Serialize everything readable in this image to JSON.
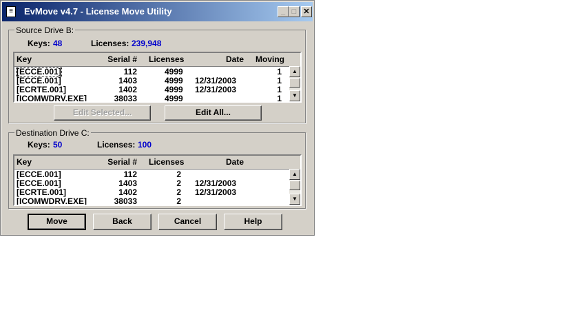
{
  "window": {
    "title": "EvMove v4.7 - License Move Utility",
    "min_glyph": "_",
    "max_glyph": "□",
    "close_glyph": "✕"
  },
  "source": {
    "label": "Source Drive B:",
    "keys_label": "Keys:",
    "keys_value": "48",
    "licenses_label": "Licenses:",
    "licenses_value": "239,948",
    "columns": {
      "key": "Key",
      "serial": "Serial #",
      "licenses": "Licenses",
      "date": "Date",
      "moving": "Moving"
    },
    "rows": [
      {
        "key": "[ECCE.001]",
        "serial": "112",
        "licenses": "4999",
        "date": "",
        "moving": "1"
      },
      {
        "key": "[ECCE.001]",
        "serial": "1403",
        "licenses": "4999",
        "date": "12/31/2003",
        "moving": "1"
      },
      {
        "key": "[ECRTE.001]",
        "serial": "1402",
        "licenses": "4999",
        "date": "12/31/2003",
        "moving": "1"
      },
      {
        "key": "[ICOMWDRV.EXE]",
        "serial": "38033",
        "licenses": "4999",
        "date": "",
        "moving": "1"
      }
    ],
    "edit_selected_label": "Edit Selected...",
    "edit_all_label": "Edit All..."
  },
  "destination": {
    "label": "Destination Drive C:",
    "keys_label": "Keys:",
    "keys_value": "50",
    "licenses_label": "Licenses:",
    "licenses_value": "100",
    "columns": {
      "key": "Key",
      "serial": "Serial #",
      "licenses": "Licenses",
      "date": "Date"
    },
    "rows": [
      {
        "key": "[ECCE.001]",
        "serial": "112",
        "licenses": "2",
        "date": ""
      },
      {
        "key": "[ECCE.001]",
        "serial": "1403",
        "licenses": "2",
        "date": "12/31/2003"
      },
      {
        "key": "[ECRTE.001]",
        "serial": "1402",
        "licenses": "2",
        "date": "12/31/2003"
      },
      {
        "key": "[ICOMWDRV.EXE]",
        "serial": "38033",
        "licenses": "2",
        "date": ""
      }
    ]
  },
  "buttons": {
    "move": "Move",
    "back": "Back",
    "cancel": "Cancel",
    "help": "Help"
  },
  "icons": {
    "app": "app-document-icon",
    "scroll_up": "▲",
    "scroll_down": "▼"
  },
  "colors": {
    "title_start": "#0a246a",
    "title_end": "#a6caf0",
    "value_blue": "#0000cc",
    "face": "#d4d0c8"
  }
}
